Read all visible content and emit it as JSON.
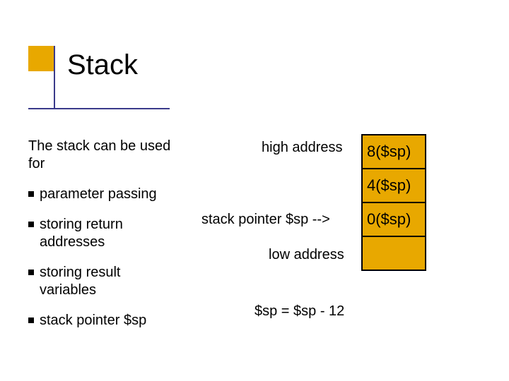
{
  "title": "Stack",
  "intro": "The stack can be used for",
  "bullets": [
    "parameter passing",
    "storing return addresses",
    "storing result variables",
    "stack pointer $sp"
  ],
  "labels": {
    "high": "high address",
    "sp_arrow": "stack pointer $sp -->",
    "low": "low address",
    "equation": "$sp = $sp - 12"
  },
  "stack_cells": [
    "8($sp)",
    "4($sp)",
    "0($sp)",
    ""
  ]
}
